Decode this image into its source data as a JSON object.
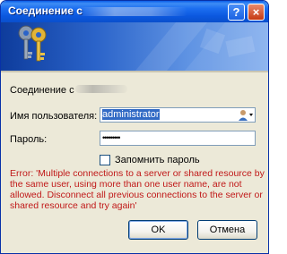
{
  "window": {
    "title": "Соединение с",
    "help_glyph": "?",
    "close_glyph": "×"
  },
  "form": {
    "connection_label": "Соединение с",
    "username_label": "Имя пользователя:",
    "username_value": "administrator",
    "password_label": "Пароль:",
    "password_value": "•••••••••",
    "remember_label": "Запомнить пароль",
    "remember_checked": false
  },
  "error": {
    "message": "Error: 'Multiple connections to a server or shared resource by the same user, using more than one user name, are not allowed. Disconnect all previous connections to the server or shared resource and try again'"
  },
  "buttons": {
    "ok_label": "OK",
    "cancel_label": "Отмена"
  },
  "icons": {
    "keys": "keys-icon",
    "user": "user-dropdown-icon"
  },
  "colors": {
    "titlebar": "#0a5ee8",
    "error_text": "#c01818",
    "selection": "#316ac5"
  }
}
